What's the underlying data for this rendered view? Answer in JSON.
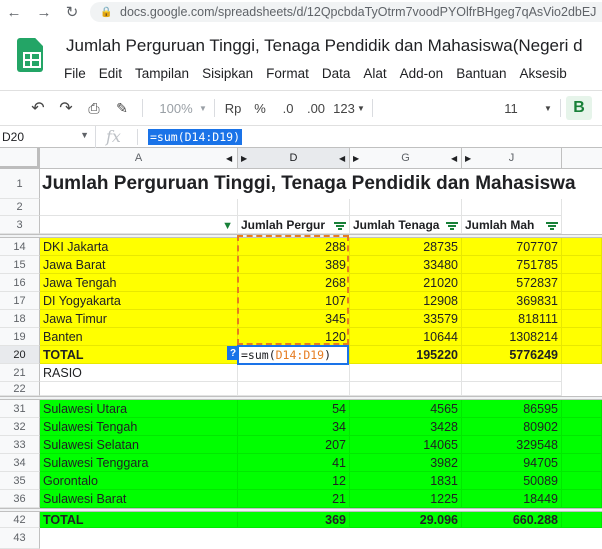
{
  "browser": {
    "url": "docs.google.com/spreadsheets/d/12QpcbdaTyOtrm7voodPYOlfrBHgeg7qAsVio2dbEJ"
  },
  "doc": {
    "title": "Jumlah Perguruan Tinggi, Tenaga Pendidik dan Mahasiswa(Negeri d",
    "menu": [
      "File",
      "Edit",
      "Tampilan",
      "Sisipkan",
      "Format",
      "Data",
      "Alat",
      "Add-on",
      "Bantuan",
      "Aksesib"
    ]
  },
  "toolbar": {
    "zoom": "100%",
    "currency": "Rp",
    "percent": "%",
    "dec_decrease": ".0",
    "dec_increase": ".00",
    "number_format": "123",
    "font_size": "11",
    "bold": "B"
  },
  "formula_bar": {
    "name_box": "D20",
    "fx": "fx",
    "formula": "=sum(D14:D19)"
  },
  "columns": [
    "A",
    "D",
    "G",
    "J"
  ],
  "sheet": {
    "title": "Jumlah Perguruan Tinggi, Tenaga Pendidik dan Mahasiswa",
    "headers": [
      "Jumlah Pergur",
      "Jumlah Tenaga",
      "Jumlah Mah"
    ],
    "rows_top": [
      {
        "row": "14",
        "name": "DKI Jakarta",
        "d": "288",
        "g": "28735",
        "j": "707707"
      },
      {
        "row": "15",
        "name": "Jawa Barat",
        "d": "389",
        "g": "33480",
        "j": "751785"
      },
      {
        "row": "16",
        "name": "Jawa Tengah",
        "d": "268",
        "g": "21020",
        "j": "572837"
      },
      {
        "row": "17",
        "name": "DI Yogyakarta",
        "d": "107",
        "g": "12908",
        "j": "369831"
      },
      {
        "row": "18",
        "name": "Jawa Timur",
        "d": "345",
        "g": "33579",
        "j": "818111"
      },
      {
        "row": "19",
        "name": "Banten",
        "d": "120",
        "g": "10644",
        "j": "1308214"
      }
    ],
    "total_top": {
      "row": "20",
      "label": "TOTAL",
      "g": "195220",
      "j": "5776249"
    },
    "rasio": {
      "row": "21",
      "label": "RASIO"
    },
    "rows_bottom": [
      {
        "row": "31",
        "name": "Sulawesi Utara",
        "d": "54",
        "g": "4565",
        "j": "86595"
      },
      {
        "row": "32",
        "name": "Sulawesi Tengah",
        "d": "34",
        "g": "3428",
        "j": "80902"
      },
      {
        "row": "33",
        "name": "Sulawesi Selatan",
        "d": "207",
        "g": "14065",
        "j": "329548"
      },
      {
        "row": "34",
        "name": "Sulawesi Tenggara",
        "d": "41",
        "g": "3982",
        "j": "94705"
      },
      {
        "row": "35",
        "name": "Gorontalo",
        "d": "12",
        "g": "1831",
        "j": "50089"
      },
      {
        "row": "36",
        "name": "Sulawesi Barat",
        "d": "21",
        "g": "1225",
        "j": "18449"
      }
    ],
    "total_bottom": {
      "row": "42",
      "label": "TOTAL",
      "d": "369",
      "g": "29.096",
      "j": "660.288"
    },
    "edit": {
      "prefix": "=sum(",
      "ref": "D14:D19",
      "suffix": ")",
      "help": "?"
    }
  },
  "colors": {
    "yellow": "#ffff00",
    "green": "#00ff00",
    "accent": "#1a73e8",
    "range": "#e67c21"
  }
}
